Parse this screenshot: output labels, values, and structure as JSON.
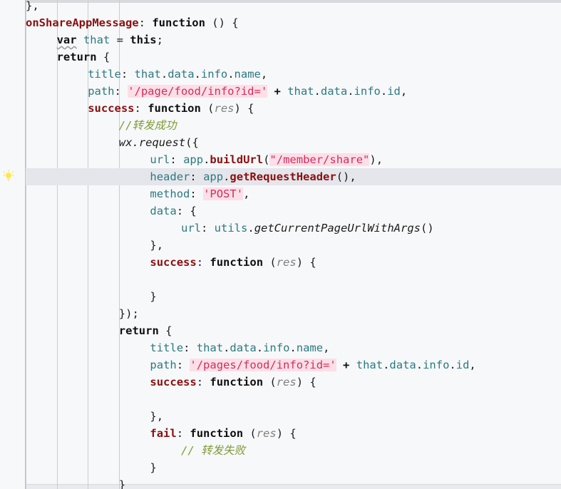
{
  "editor": {
    "theme": "light",
    "font": "monospace",
    "colors": {
      "background": "#f7f8fa",
      "caret_line": "#e4e6eb",
      "gutter_border": "#bfc3c9",
      "indent_guide": "#c9ccd3",
      "property": "#8a1010",
      "identifier": "#2b7a80",
      "string_text": "#d42c5e",
      "string_background": "#fcdfe7",
      "comment": "#7f9a36",
      "parameter": "#7f7f7f",
      "plain": "#1c1c1c"
    },
    "caret_line_number": 10,
    "gutter": {
      "icon": "lightbulb-icon",
      "icon_color": "#fbe84f",
      "icon_line": 10
    },
    "indent_guide_x": [
      36,
      80,
      123,
      167
    ],
    "warning_token": "var"
  },
  "code": {
    "language": "javascript",
    "lines": [
      {
        "indent": 0,
        "clipped_top": true,
        "tokens": [
          {
            "t": "},",
            "c": "plain"
          }
        ]
      },
      {
        "indent": 0,
        "tokens": [
          {
            "t": "onShareAppMessage",
            "c": "prop"
          },
          {
            "t": ": ",
            "c": "punct"
          },
          {
            "t": "function",
            "c": "kw"
          },
          {
            "t": " () {",
            "c": "punct"
          }
        ]
      },
      {
        "indent": 1,
        "tokens": [
          {
            "t": "var",
            "c": "kw",
            "squiggle": true
          },
          {
            "t": " ",
            "c": "punct"
          },
          {
            "t": "that",
            "c": "ident"
          },
          {
            "t": " = ",
            "c": "punct"
          },
          {
            "t": "this",
            "c": "kw"
          },
          {
            "t": ";",
            "c": "punct"
          }
        ]
      },
      {
        "indent": 1,
        "tokens": [
          {
            "t": "return",
            "c": "kw"
          },
          {
            "t": " {",
            "c": "punct"
          }
        ]
      },
      {
        "indent": 2,
        "tokens": [
          {
            "t": "title",
            "c": "key"
          },
          {
            "t": ": ",
            "c": "punct"
          },
          {
            "t": "that",
            "c": "ident"
          },
          {
            "t": ".",
            "c": "punct"
          },
          {
            "t": "data",
            "c": "ident"
          },
          {
            "t": ".",
            "c": "punct"
          },
          {
            "t": "info",
            "c": "ident"
          },
          {
            "t": ".",
            "c": "punct"
          },
          {
            "t": "name",
            "c": "ident"
          },
          {
            "t": ",",
            "c": "punct"
          }
        ]
      },
      {
        "indent": 2,
        "tokens": [
          {
            "t": "path",
            "c": "key"
          },
          {
            "t": ": ",
            "c": "punct"
          },
          {
            "t": "'/page/food/info?id='",
            "c": "str"
          },
          {
            "t": " ",
            "c": "punct"
          },
          {
            "t": "+",
            "c": "op"
          },
          {
            "t": " ",
            "c": "punct"
          },
          {
            "t": "that",
            "c": "ident"
          },
          {
            "t": ".",
            "c": "punct"
          },
          {
            "t": "data",
            "c": "ident"
          },
          {
            "t": ".",
            "c": "punct"
          },
          {
            "t": "info",
            "c": "ident"
          },
          {
            "t": ".",
            "c": "punct"
          },
          {
            "t": "id",
            "c": "ident"
          },
          {
            "t": ",",
            "c": "punct"
          }
        ]
      },
      {
        "indent": 2,
        "tokens": [
          {
            "t": "success",
            "c": "prop"
          },
          {
            "t": ": ",
            "c": "punct"
          },
          {
            "t": "function",
            "c": "kw"
          },
          {
            "t": " (",
            "c": "punct"
          },
          {
            "t": "res",
            "c": "param"
          },
          {
            "t": ") {",
            "c": "punct"
          }
        ]
      },
      {
        "indent": 3,
        "tokens": [
          {
            "t": "//转发成功",
            "c": "comment"
          }
        ]
      },
      {
        "indent": 3,
        "tokens": [
          {
            "t": "wx",
            "c": "fnitalic"
          },
          {
            "t": ".",
            "c": "fnitalic"
          },
          {
            "t": "request",
            "c": "fnitalic"
          },
          {
            "t": "({",
            "c": "punct"
          }
        ]
      },
      {
        "indent": 4,
        "tokens": [
          {
            "t": "url",
            "c": "key"
          },
          {
            "t": ": ",
            "c": "punct"
          },
          {
            "t": "app",
            "c": "ident"
          },
          {
            "t": ".",
            "c": "punct"
          },
          {
            "t": "buildUrl",
            "c": "method"
          },
          {
            "t": "(",
            "c": "punct"
          },
          {
            "t": "\"/member/share\"",
            "c": "str"
          },
          {
            "t": "),",
            "c": "punct"
          }
        ]
      },
      {
        "indent": 4,
        "caret": true,
        "tokens": [
          {
            "t": "header",
            "c": "key"
          },
          {
            "t": ": ",
            "c": "punct"
          },
          {
            "t": "app",
            "c": "ident"
          },
          {
            "t": ".",
            "c": "punct"
          },
          {
            "t": "getRequestHeader",
            "c": "method"
          },
          {
            "t": "(),",
            "c": "punct"
          }
        ]
      },
      {
        "indent": 4,
        "tokens": [
          {
            "t": "method",
            "c": "key"
          },
          {
            "t": ": ",
            "c": "punct"
          },
          {
            "t": "'POST'",
            "c": "str"
          },
          {
            "t": ",",
            "c": "punct"
          }
        ]
      },
      {
        "indent": 4,
        "tokens": [
          {
            "t": "data",
            "c": "key"
          },
          {
            "t": ": {",
            "c": "punct"
          }
        ]
      },
      {
        "indent": 5,
        "tokens": [
          {
            "t": "url",
            "c": "key"
          },
          {
            "t": ": ",
            "c": "punct"
          },
          {
            "t": "utils",
            "c": "ident"
          },
          {
            "t": ".",
            "c": "punct"
          },
          {
            "t": "getCurrentPageUrlWithArgs",
            "c": "fnitalic"
          },
          {
            "t": "()",
            "c": "punct"
          }
        ]
      },
      {
        "indent": 4,
        "tokens": [
          {
            "t": "},",
            "c": "punct"
          }
        ]
      },
      {
        "indent": 4,
        "tokens": [
          {
            "t": "success",
            "c": "prop"
          },
          {
            "t": ": ",
            "c": "punct"
          },
          {
            "t": "function",
            "c": "kw"
          },
          {
            "t": " (",
            "c": "punct"
          },
          {
            "t": "res",
            "c": "param"
          },
          {
            "t": ") {",
            "c": "punct"
          }
        ]
      },
      {
        "indent": 0,
        "tokens": []
      },
      {
        "indent": 4,
        "tokens": [
          {
            "t": "}",
            "c": "punct"
          }
        ]
      },
      {
        "indent": 3,
        "tokens": [
          {
            "t": "});",
            "c": "punct"
          }
        ]
      },
      {
        "indent": 3,
        "tokens": [
          {
            "t": "return",
            "c": "kw"
          },
          {
            "t": " {",
            "c": "punct"
          }
        ]
      },
      {
        "indent": 4,
        "tokens": [
          {
            "t": "title",
            "c": "key"
          },
          {
            "t": ": ",
            "c": "punct"
          },
          {
            "t": "that",
            "c": "ident"
          },
          {
            "t": ".",
            "c": "punct"
          },
          {
            "t": "data",
            "c": "ident"
          },
          {
            "t": ".",
            "c": "punct"
          },
          {
            "t": "info",
            "c": "ident"
          },
          {
            "t": ".",
            "c": "punct"
          },
          {
            "t": "name",
            "c": "ident"
          },
          {
            "t": ",",
            "c": "punct"
          }
        ]
      },
      {
        "indent": 4,
        "tokens": [
          {
            "t": "path",
            "c": "key"
          },
          {
            "t": ": ",
            "c": "punct"
          },
          {
            "t": "'/pages/food/info?id='",
            "c": "str"
          },
          {
            "t": " ",
            "c": "punct"
          },
          {
            "t": "+",
            "c": "op"
          },
          {
            "t": " ",
            "c": "punct"
          },
          {
            "t": "that",
            "c": "ident"
          },
          {
            "t": ".",
            "c": "punct"
          },
          {
            "t": "data",
            "c": "ident"
          },
          {
            "t": ".",
            "c": "punct"
          },
          {
            "t": "info",
            "c": "ident"
          },
          {
            "t": ".",
            "c": "punct"
          },
          {
            "t": "id",
            "c": "ident"
          },
          {
            "t": ",",
            "c": "punct"
          }
        ]
      },
      {
        "indent": 4,
        "tokens": [
          {
            "t": "success",
            "c": "prop"
          },
          {
            "t": ": ",
            "c": "punct"
          },
          {
            "t": "function",
            "c": "kw"
          },
          {
            "t": " (",
            "c": "punct"
          },
          {
            "t": "res",
            "c": "param"
          },
          {
            "t": ") {",
            "c": "punct"
          }
        ]
      },
      {
        "indent": 0,
        "tokens": []
      },
      {
        "indent": 4,
        "tokens": [
          {
            "t": "},",
            "c": "punct"
          }
        ]
      },
      {
        "indent": 4,
        "tokens": [
          {
            "t": "fail",
            "c": "prop"
          },
          {
            "t": ": ",
            "c": "punct"
          },
          {
            "t": "function",
            "c": "kw"
          },
          {
            "t": " (",
            "c": "punct"
          },
          {
            "t": "res",
            "c": "param"
          },
          {
            "t": ") {",
            "c": "punct"
          }
        ]
      },
      {
        "indent": 5,
        "tokens": [
          {
            "t": "// 转发失败",
            "c": "comment"
          }
        ]
      },
      {
        "indent": 4,
        "tokens": [
          {
            "t": "}",
            "c": "punct"
          }
        ]
      },
      {
        "indent": 3,
        "tokens": [
          {
            "t": "}",
            "c": "punct"
          }
        ]
      }
    ]
  }
}
